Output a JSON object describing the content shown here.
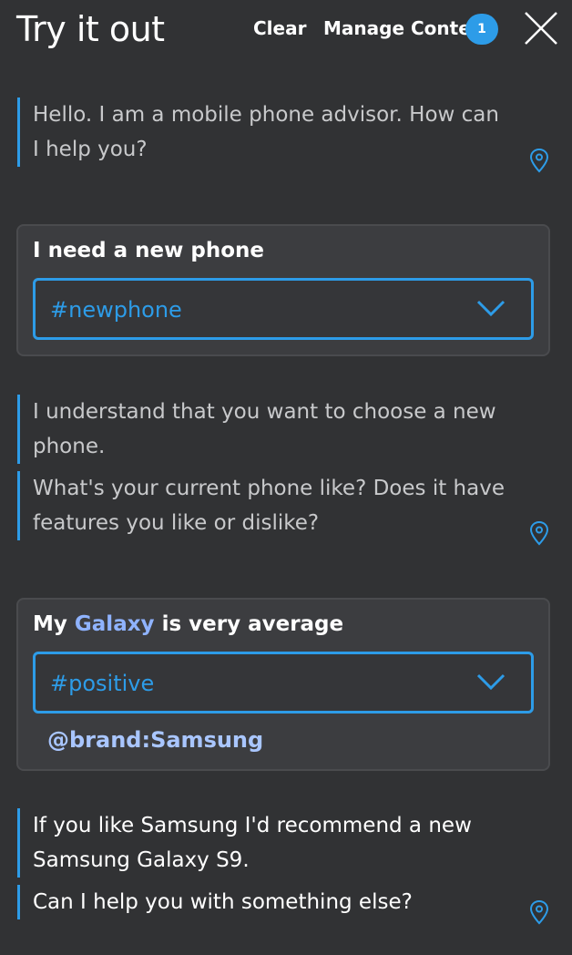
{
  "header": {
    "title": "Try it out",
    "clear_label": "Clear",
    "manage_context_label": "Manage Context",
    "context_count": "1",
    "close_icon": "close-icon"
  },
  "conversation": {
    "bot_1": {
      "line_1": "Hello. I am a mobile phone advisor. How can",
      "line_2": "I help you?"
    },
    "user_1": {
      "text": "I need a new phone",
      "intent": "#newphone"
    },
    "bot_2": {
      "msg_1_line_1": "I understand that you want to choose a new",
      "msg_1_line_2": "phone.",
      "msg_2_line_1": "What's your current phone like? Does it have",
      "msg_2_line_2": "features you like or dislike?"
    },
    "user_2": {
      "text_before": "My",
      "text_highlight": "Galaxy",
      "text_after": "is very average",
      "intent": "#positive",
      "entity": "@brand:Samsung"
    },
    "bot_3": {
      "msg_1_line_1": "If you like Samsung I'd recommend a new",
      "msg_1_line_2": "Samsung Galaxy S9.",
      "msg_2_line_1": "Can I help you with something else?"
    }
  },
  "colors": {
    "background": "#313234",
    "accent": "#2d9ce8",
    "card": "#3c3d40",
    "entity": "#a9c6ff"
  }
}
